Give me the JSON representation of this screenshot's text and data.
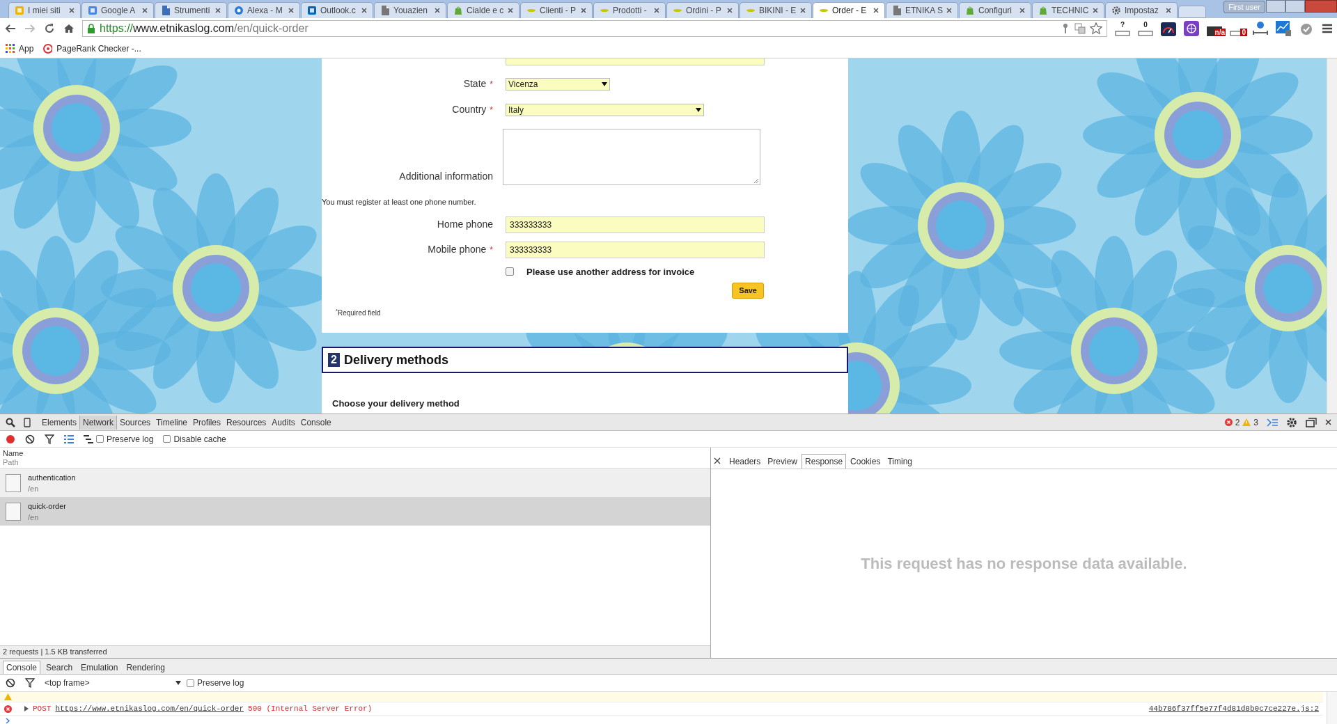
{
  "browser": {
    "tabs": [
      {
        "title": "I miei siti",
        "icon": {
          "kind": "tile",
          "color": "#f0b400"
        },
        "selected": false
      },
      {
        "title": "Google A",
        "icon": {
          "kind": "tile",
          "color": "#4a86e8"
        },
        "selected": false
      },
      {
        "title": "Strumenti",
        "icon": {
          "kind": "page",
          "color": "#3d6fb6"
        },
        "selected": false
      },
      {
        "title": "Alexa - M",
        "icon": {
          "kind": "circle",
          "color": "#2a7ad8"
        },
        "selected": false
      },
      {
        "title": "Outlook.c",
        "icon": {
          "kind": "tile",
          "color": "#0a64b4"
        },
        "selected": false
      },
      {
        "title": "Youazien",
        "icon": {
          "kind": "page",
          "color": "#777777"
        },
        "selected": false
      },
      {
        "title": "Cialde e c",
        "icon": {
          "kind": "bag",
          "color": "#5fa83c"
        },
        "selected": false
      },
      {
        "title": "Clienti - P",
        "icon": {
          "kind": "logo",
          "color": "#c8c800"
        },
        "selected": false
      },
      {
        "title": "Prodotti -",
        "icon": {
          "kind": "logo",
          "color": "#c8c800"
        },
        "selected": false
      },
      {
        "title": "Ordini - P",
        "icon": {
          "kind": "logo",
          "color": "#c8c800"
        },
        "selected": false
      },
      {
        "title": "BIKINI - E",
        "icon": {
          "kind": "logo",
          "color": "#c8c800"
        },
        "selected": false
      },
      {
        "title": "Order - E",
        "icon": {
          "kind": "logo",
          "color": "#c8c800"
        },
        "selected": true
      },
      {
        "title": "ETNIKA S",
        "icon": {
          "kind": "page",
          "color": "#777777"
        },
        "selected": false
      },
      {
        "title": "Configuri",
        "icon": {
          "kind": "bag",
          "color": "#5fa83c"
        },
        "selected": false
      },
      {
        "title": "TECHNIC",
        "icon": {
          "kind": "bag",
          "color": "#5fa83c"
        },
        "selected": false
      },
      {
        "title": "Impostaz",
        "icon": {
          "kind": "gear",
          "color": "#555555"
        },
        "selected": false
      }
    ],
    "profile_button": "First user",
    "address": {
      "scheme": "https://",
      "host": "www.etnikaslog.com",
      "path": "/en/quick-order"
    },
    "extensions": [
      {
        "kind": "bar",
        "badge": "?"
      },
      {
        "kind": "bar",
        "badge": "0"
      },
      {
        "kind": "gauge"
      },
      {
        "kind": "globe"
      },
      {
        "kind": "tile",
        "badge": "n/a"
      },
      {
        "kind": "redbar",
        "badge": "0"
      },
      {
        "kind": "scale"
      },
      {
        "kind": "chart"
      },
      {
        "kind": "check"
      }
    ],
    "bookmarks": [
      {
        "label": "App",
        "kind": "apps"
      },
      {
        "label": "PageRank Checker -...",
        "kind": "target"
      }
    ]
  },
  "form": {
    "required_mark": "*",
    "fields": [
      {
        "kind": "select",
        "label": "State",
        "required": true,
        "value": "Vicenza"
      },
      {
        "kind": "select",
        "label": "Country",
        "required": true,
        "value": "Italy"
      },
      {
        "kind": "textarea",
        "label": "Additional information",
        "required": false
      },
      {
        "kind": "note",
        "text": "You must register at least one phone number."
      },
      {
        "kind": "text",
        "label": "Home phone",
        "required": false,
        "value": "333333333"
      },
      {
        "kind": "text",
        "label": "Mobile phone",
        "required": true,
        "value": "333333333"
      },
      {
        "kind": "checkbox",
        "label": "Please use another address for invoice",
        "checked": false
      }
    ],
    "save_button": "Save",
    "required_note": "$^{*}$Required field"
  },
  "delivery": {
    "number": "2",
    "title": "Delivery methods",
    "subtitle": "Choose your delivery method"
  },
  "devtools": {
    "panels": [
      {
        "label": "Elements",
        "selected": false
      },
      {
        "label": "Network",
        "selected": true
      },
      {
        "label": "Sources",
        "selected": false
      },
      {
        "label": "Timeline",
        "selected": false
      },
      {
        "label": "Profiles",
        "selected": false
      },
      {
        "label": "Resources",
        "selected": false
      },
      {
        "label": "Audits",
        "selected": false
      },
      {
        "label": "Console",
        "selected": false
      }
    ],
    "errors": "2",
    "warnings": "3",
    "network_toolbar": {
      "recording": true,
      "preserve_log": {
        "label": "Preserve log",
        "checked": false
      },
      "disable_cache": {
        "label": "Disable cache",
        "checked": false
      }
    },
    "requests_header": {
      "name": "Name",
      "path": "Path"
    },
    "requests": [
      {
        "name": "authentication",
        "path": "/en",
        "selected": false
      },
      {
        "name": "quick-order",
        "path": "/en",
        "selected": true
      }
    ],
    "summary": "2 requests | 1.5 KB transferred",
    "detail_tabs": [
      {
        "label": "Headers",
        "selected": false
      },
      {
        "label": "Preview",
        "selected": false
      },
      {
        "label": "Response",
        "selected": true
      },
      {
        "label": "Cookies",
        "selected": false
      },
      {
        "label": "Timing",
        "selected": false
      }
    ],
    "empty_message": "This request has no response data available.",
    "drawer_tabs": [
      {
        "label": "Console",
        "selected": true
      },
      {
        "label": "Search",
        "selected": false
      },
      {
        "label": "Emulation",
        "selected": false
      },
      {
        "label": "Rendering",
        "selected": false
      }
    ],
    "console_toolbar": {
      "context": "<top frame>",
      "preserve_log": {
        "label": "Preserve log",
        "checked": false
      }
    },
    "messages": [
      {
        "kind": "warning"
      },
      {
        "kind": "error",
        "method": "POST",
        "url": "https://www.etnikaslog.com/en/quick-order",
        "status": "500 (Internal Server Error)",
        "source": "44b786f37ff5e77f4d81d8b0c7ce227e.js:2"
      }
    ]
  }
}
